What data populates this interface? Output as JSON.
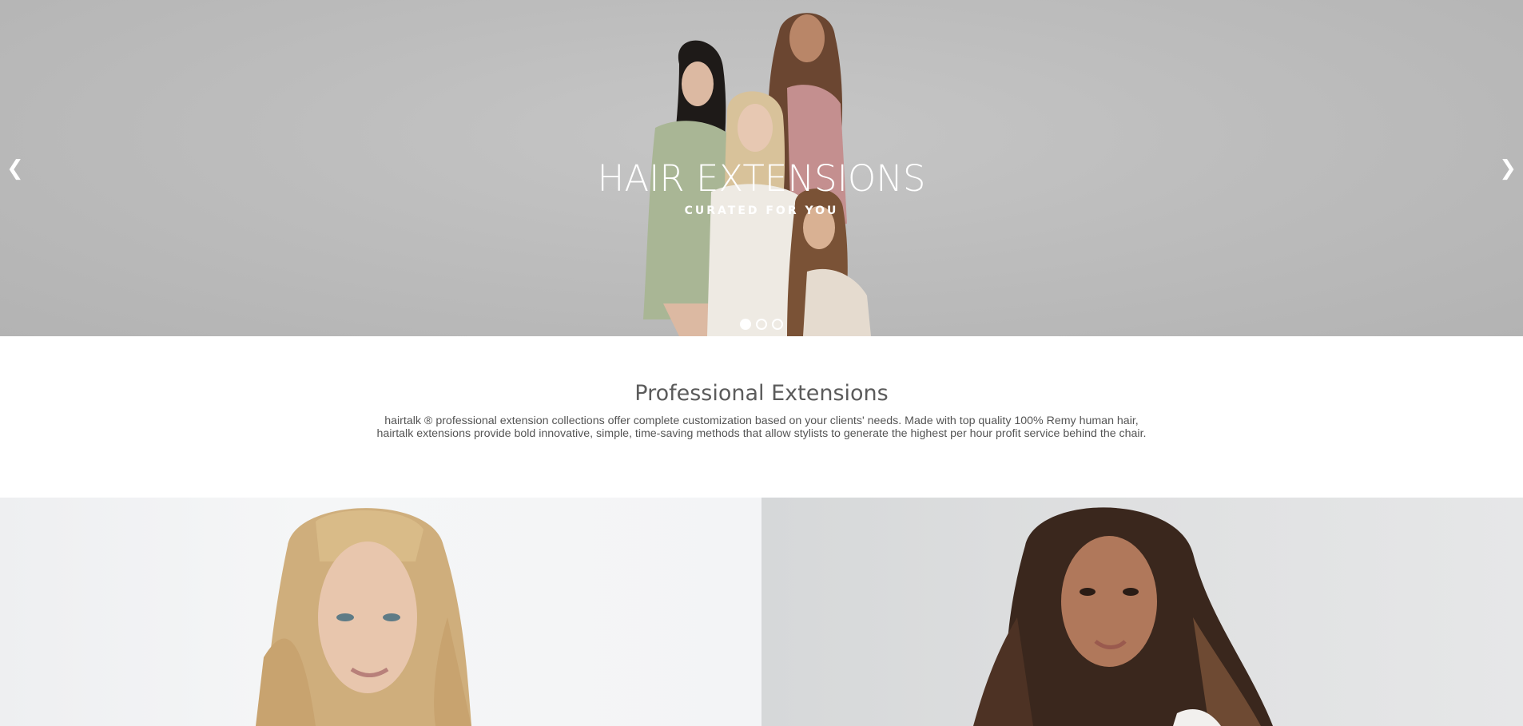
{
  "hero": {
    "title": "HAIR EXTENSIONS",
    "subtitle": "CURATED FOR YOU",
    "prev_arrow": "❮",
    "next_arrow": "❯",
    "slides_count": 3,
    "active_slide": 1
  },
  "intro": {
    "title": "Professional Extensions",
    "body_line1": "hairtalk ® professional extension collections offer complete customization based on your clients' needs. Made with top quality 100% Remy human hair,",
    "body_line2": "hairtalk extensions provide bold innovative, simple, time-saving methods that allow stylists to generate the highest per hour profit service behind the chair."
  },
  "colors": {
    "hero_bg": "#bdbdbd",
    "heading_text": "#5b5b5b",
    "body_text": "#555555"
  }
}
